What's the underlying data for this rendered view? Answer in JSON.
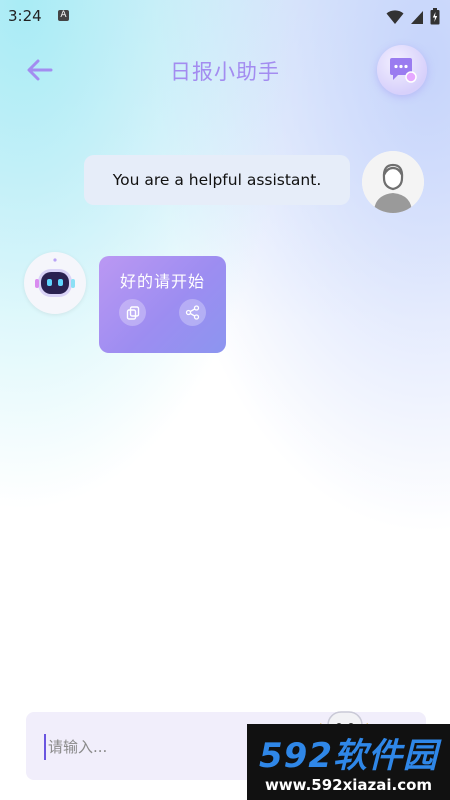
{
  "status_bar": {
    "time": "3:24",
    "notification_glyph": "A",
    "icons": [
      "wifi-icon",
      "signal-icon",
      "battery-icon"
    ]
  },
  "header": {
    "title": "日报小助手",
    "back_icon": "back-arrow-icon",
    "history_icon": "chat-history-icon",
    "accent_color": "#a38cf0"
  },
  "messages": [
    {
      "role": "user",
      "text": "You are a helpful assistant.",
      "avatar_icon": "user-avatar-icon"
    },
    {
      "role": "assistant",
      "text": "好的请开始",
      "avatar_icon": "robot-avatar-icon",
      "actions": [
        "copy-icon",
        "share-icon"
      ]
    }
  ],
  "input": {
    "placeholder": "请输入...",
    "value": ""
  },
  "watermark": {
    "main": "592软件园",
    "sub": "www.592xiazai.com"
  }
}
